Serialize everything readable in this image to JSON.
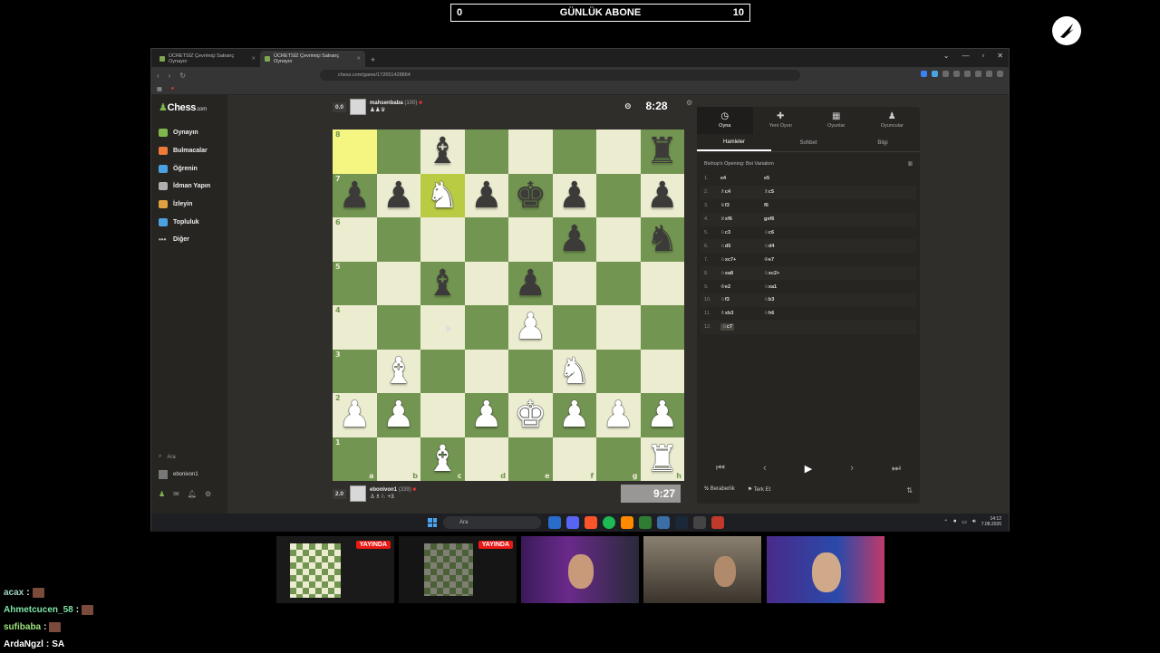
{
  "overlay": {
    "sub_goal_left": "0",
    "sub_goal_title": "GÜNLÜK ABONE",
    "sub_goal_right": "10"
  },
  "browser": {
    "tabs": [
      {
        "label": "ÜCRETSİZ Çevrimiçi Satranç Oynayın",
        "active": false
      },
      {
        "label": "ÜCRETSİZ Çevrimiçi Satranç Oynayın",
        "active": true
      }
    ],
    "url": "chess.com/game/172651428864"
  },
  "sidebar": {
    "logo": "Chess",
    "logo_suffix": ".com",
    "items": [
      {
        "label": "Oynayın",
        "color": "#81b64c"
      },
      {
        "label": "Bulmacalar",
        "color": "#f07b38"
      },
      {
        "label": "Öğrenin",
        "color": "#4aa3e0"
      },
      {
        "label": "İdman Yapın",
        "color": "#b0b0b0"
      },
      {
        "label": "İzleyin",
        "color": "#e0a040"
      },
      {
        "label": "Topluluk",
        "color": "#4aa3e0"
      },
      {
        "label": "Diğer",
        "color": "#bbbbbb"
      }
    ],
    "search_label": "Ara",
    "username": "ebonivon1"
  },
  "game": {
    "top_player": {
      "score": "0.0",
      "name": "mahsenbaba",
      "rating": "(100)",
      "captured": "♟♟♛",
      "clock": "8:28"
    },
    "bottom_player": {
      "score": "2.0",
      "name": "ebonivon1",
      "rating": "(339)",
      "captured": "♙♗♘ +3",
      "clock": "9:27"
    },
    "board": [
      [
        "",
        "",
        "b",
        "",
        "",
        "",
        "",
        "r"
      ],
      [
        "p",
        "p",
        "N",
        "p",
        "k",
        "p",
        "",
        "p"
      ],
      [
        "",
        "",
        "",
        "",
        "",
        "p",
        "",
        "n"
      ],
      [
        "",
        "",
        "b",
        "",
        "p",
        "",
        "",
        ""
      ],
      [
        "",
        "",
        "",
        "",
        "P",
        "",
        "",
        ""
      ],
      [
        "",
        "B",
        "",
        "",
        "",
        "N",
        "",
        ""
      ],
      [
        "P",
        "P",
        "",
        "P",
        "K",
        "P",
        "P",
        "P"
      ],
      [
        "",
        "",
        "B",
        "",
        "",
        "",
        "",
        "R"
      ]
    ],
    "highlight": [
      [
        0,
        0
      ],
      [
        1,
        2
      ]
    ],
    "ranks": [
      "8",
      "7",
      "6",
      "5",
      "4",
      "3",
      "2",
      "1"
    ],
    "files": [
      "a",
      "b",
      "c",
      "d",
      "e",
      "f",
      "g",
      "h"
    ]
  },
  "panel": {
    "top_tabs": [
      {
        "label": "Oyna",
        "icon": "◷"
      },
      {
        "label": "Yeni Oyun",
        "icon": "✚"
      },
      {
        "label": "Oyunlar",
        "icon": "▦"
      },
      {
        "label": "Oyuncular",
        "icon": "♟"
      }
    ],
    "sub_tabs": [
      "Hamleler",
      "Sohbet",
      "Bilgi"
    ],
    "opening": "Bishop's Opening: Boi Variation",
    "moves": [
      {
        "n": "1.",
        "w": "e4",
        "b": "e5"
      },
      {
        "n": "2.",
        "w": "♗c4",
        "b": "♗c5"
      },
      {
        "n": "3.",
        "w": "♕f3",
        "b": "f6"
      },
      {
        "n": "4.",
        "w": "♕xf6",
        "b": "gxf6"
      },
      {
        "n": "5.",
        "w": "♘c3",
        "b": "♘c6"
      },
      {
        "n": "6.",
        "w": "♘d5",
        "b": "♘d4"
      },
      {
        "n": "7.",
        "w": "♘xc7+",
        "b": "♔e7"
      },
      {
        "n": "8.",
        "w": "♘xa8",
        "b": "♘xc2+"
      },
      {
        "n": "9.",
        "w": "♔e2",
        "b": "♘xa1"
      },
      {
        "n": "10.",
        "w": "♘f3",
        "b": "♘b3"
      },
      {
        "n": "11.",
        "w": "♗xb3",
        "b": "♘h6"
      },
      {
        "n": "12.",
        "w": "♘c7",
        "b": ""
      }
    ],
    "draw_label": "Beraberlik",
    "draw_prefix": "½",
    "resign_label": "Terk Et"
  },
  "taskbar": {
    "search": "Ara",
    "time": "14:12",
    "date": "7.08.2026"
  },
  "cams": [
    {
      "live": "YAYINDA"
    },
    {
      "live": "YAYINDA"
    }
  ],
  "chat": [
    {
      "user": "acax",
      "color": "#9fd3c7",
      "message": ""
    },
    {
      "user": "Ahmetcucen_58",
      "color": "#7fe3a8",
      "message": ""
    },
    {
      "user": "sufibaba",
      "color": "#9fe37f",
      "message": ""
    },
    {
      "user": "ArdaNgzl",
      "color": "#ffffff",
      "message": "SA"
    }
  ]
}
